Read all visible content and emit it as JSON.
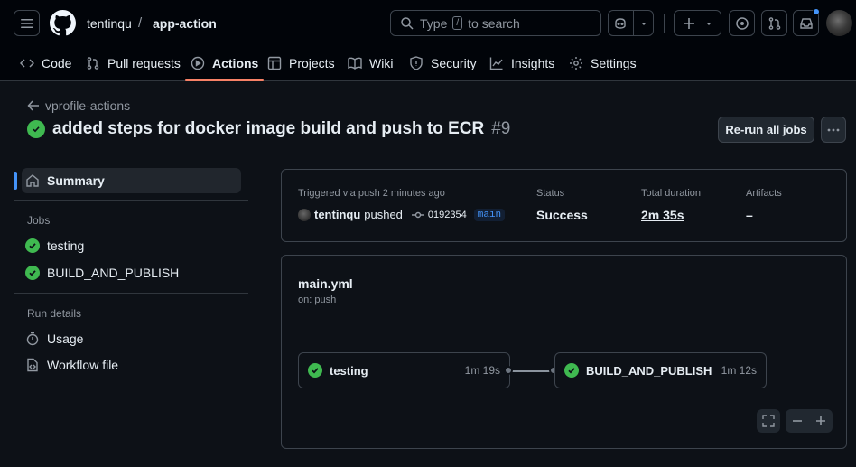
{
  "header": {
    "owner": "tentinqu",
    "separator": "/",
    "repo": "app-action",
    "search_prefix": "Type",
    "search_key": "/",
    "search_suffix": "to search"
  },
  "tabs": [
    {
      "label": "Code",
      "icon": "code-icon"
    },
    {
      "label": "Pull requests",
      "icon": "pull-request-icon"
    },
    {
      "label": "Actions",
      "icon": "play-icon",
      "active": true
    },
    {
      "label": "Projects",
      "icon": "table-icon"
    },
    {
      "label": "Wiki",
      "icon": "book-icon"
    },
    {
      "label": "Security",
      "icon": "shield-icon"
    },
    {
      "label": "Insights",
      "icon": "graph-icon"
    },
    {
      "label": "Settings",
      "icon": "gear-icon"
    }
  ],
  "run": {
    "back_label": "vprofile-actions",
    "title": "added steps for docker image build and push to ECR",
    "number": "#9",
    "rerun_label": "Re-run all jobs"
  },
  "sidebar": {
    "summary_label": "Summary",
    "jobs_heading": "Jobs",
    "jobs": [
      "testing",
      "BUILD_AND_PUBLISH"
    ],
    "details_heading": "Run details",
    "usage_label": "Usage",
    "workflow_file_label": "Workflow file"
  },
  "summary": {
    "triggered": "Triggered via push 2 minutes ago",
    "actor": "tentinqu",
    "action": "pushed",
    "commit": "0192354",
    "branch": "main",
    "status_label": "Status",
    "status_value": "Success",
    "duration_label": "Total duration",
    "duration_value": "2m 35s",
    "artifacts_label": "Artifacts",
    "artifacts_value": "–"
  },
  "workflow": {
    "file": "main.yml",
    "trigger": "on: push",
    "jobs": [
      {
        "name": "testing",
        "duration": "1m 19s"
      },
      {
        "name": "BUILD_AND_PUBLISH",
        "duration": "1m 12s"
      }
    ]
  },
  "colors": {
    "success": "#3fb950",
    "accent_tab": "#f78166",
    "link": "#4493f8"
  }
}
